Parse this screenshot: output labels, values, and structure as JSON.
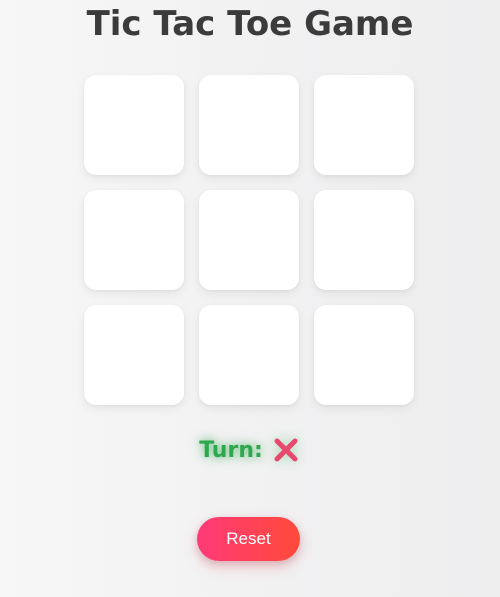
{
  "header": {
    "title": "Tic Tac Toe Game"
  },
  "board": {
    "cells": [
      "",
      "",
      "",
      "",
      "",
      "",
      "",
      "",
      ""
    ]
  },
  "status": {
    "turn_label": "Turn:",
    "current_player_icon": "cross-mark-icon",
    "turn_color": "#2ea84c",
    "mark_color": "#e8476e"
  },
  "controls": {
    "reset_label": "Reset",
    "reset_gradient": [
      "#ff3a78",
      "#ff4a3a"
    ]
  }
}
